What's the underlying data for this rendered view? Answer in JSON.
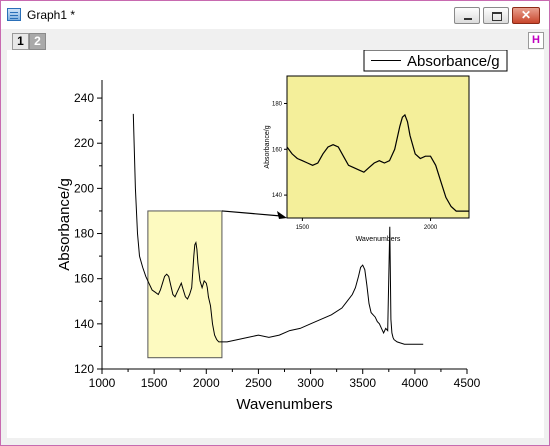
{
  "window": {
    "title": "Graph1 *"
  },
  "layers": {
    "tab1": "1",
    "tab2": "2",
    "h_button": "H"
  },
  "legend": {
    "label": "Absorbance/g"
  },
  "colors": {
    "highlight_fill": "#fdfac0",
    "inset_fill": "#f4ef9a",
    "line": "#000000"
  },
  "chart_data": [
    {
      "type": "line",
      "xlabel": "Wavenumbers",
      "ylabel": "Absorbance/g",
      "xlim": [
        1000,
        4500
      ],
      "ylim": [
        120,
        248
      ],
      "xticks": [
        1000,
        1500,
        2000,
        2500,
        3000,
        3500,
        4000,
        4500
      ],
      "yticks": [
        120,
        140,
        160,
        180,
        200,
        220,
        240
      ],
      "series": [
        {
          "name": "Absorbance/g",
          "x": [
            1300,
            1305,
            1320,
            1340,
            1360,
            1390,
            1420,
            1450,
            1480,
            1510,
            1540,
            1560,
            1580,
            1600,
            1620,
            1640,
            1660,
            1680,
            1700,
            1720,
            1740,
            1760,
            1780,
            1800,
            1820,
            1840,
            1860,
            1880,
            1890,
            1900,
            1910,
            1920,
            1940,
            1960,
            1980,
            2000,
            2010,
            2020,
            2040,
            2060,
            2080,
            2100,
            2120,
            2140,
            2200,
            2300,
            2400,
            2500,
            2600,
            2700,
            2800,
            2900,
            3000,
            3100,
            3200,
            3300,
            3350,
            3400,
            3430,
            3460,
            3480,
            3500,
            3520,
            3540,
            3560,
            3580,
            3600,
            3620,
            3640,
            3660,
            3680,
            3700,
            3720,
            3740,
            3760,
            3770,
            3780,
            3790,
            3800,
            3830,
            3900,
            4000,
            4080
          ],
          "y": [
            233,
            225,
            200,
            180,
            170,
            165,
            161,
            158,
            155,
            154,
            153,
            155,
            158,
            161,
            162,
            161,
            157,
            153,
            152,
            154,
            156,
            158,
            155,
            152,
            151,
            153,
            156,
            170,
            175,
            176,
            173,
            167,
            159,
            156,
            159,
            158,
            156,
            152,
            148,
            140,
            135,
            133,
            132,
            132,
            132,
            133,
            134,
            135,
            134,
            135,
            137,
            138,
            140,
            142,
            144,
            147,
            150,
            153,
            156,
            161,
            165,
            166,
            164,
            157,
            149,
            145,
            144,
            143,
            141,
            140,
            138,
            136,
            138,
            137,
            183,
            142,
            136,
            134,
            133,
            132,
            131,
            131,
            131
          ]
        }
      ]
    },
    {
      "type": "line",
      "title": "",
      "xlabel": "Wavenumbers",
      "ylabel": "Absorbance/g",
      "xlim": [
        1440,
        2150
      ],
      "ylim": [
        130,
        192
      ],
      "xticks": [
        1500,
        2000
      ],
      "yticks": [
        140,
        160,
        180
      ],
      "series": [
        {
          "name": "Absorbance/g",
          "x": [
            1440,
            1460,
            1480,
            1500,
            1520,
            1540,
            1560,
            1580,
            1600,
            1620,
            1640,
            1660,
            1680,
            1700,
            1720,
            1740,
            1760,
            1780,
            1800,
            1820,
            1840,
            1860,
            1880,
            1890,
            1900,
            1910,
            1920,
            1940,
            1960,
            1980,
            2000,
            2020,
            2040,
            2060,
            2080,
            2100,
            2120,
            2150
          ],
          "y": [
            161,
            158,
            156,
            155,
            154,
            153,
            154,
            158,
            161,
            162,
            161,
            157,
            153,
            152,
            151,
            150,
            152,
            154,
            155,
            154,
            155,
            160,
            170,
            174,
            175,
            172,
            166,
            158,
            156,
            157,
            157,
            153,
            146,
            139,
            135,
            133,
            133,
            133
          ]
        }
      ]
    }
  ]
}
